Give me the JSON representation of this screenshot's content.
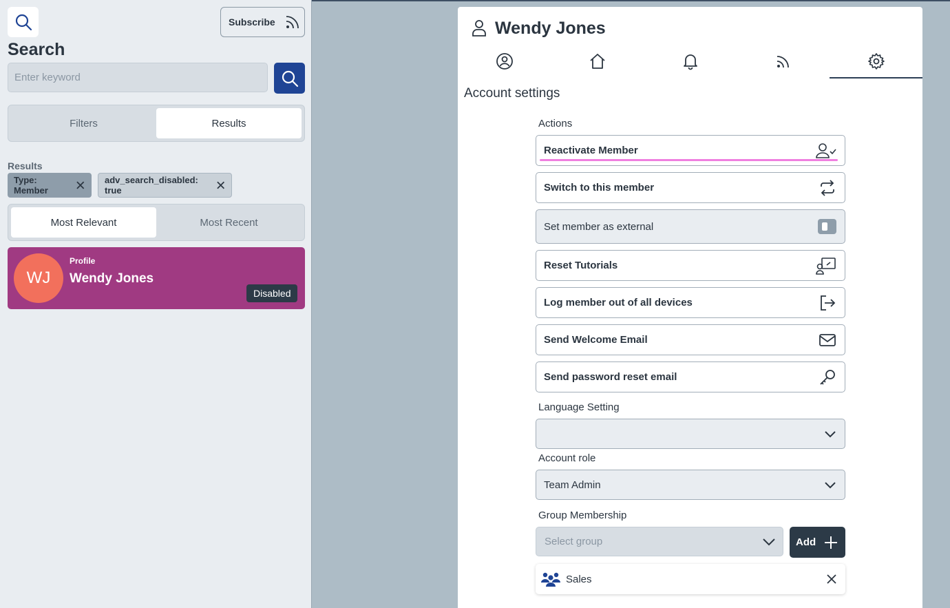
{
  "search": {
    "title": "Search",
    "placeholder": "Enter keyword",
    "subscribe_label": "Subscribe"
  },
  "view_toggle": {
    "options": [
      "Filters",
      "Results"
    ],
    "active": "Results"
  },
  "results": {
    "label": "Results",
    "chips": [
      "Type: Member",
      "adv_search_disabled: true"
    ],
    "sort_options": [
      "Most Relevant",
      "Most Recent"
    ],
    "sort_active": "Most Relevant",
    "card": {
      "kind": "Profile",
      "initials": "WJ",
      "name": "Wendy Jones",
      "status": "Disabled",
      "color": "#a03a82",
      "avatar_color": "#f2705c"
    }
  },
  "panel": {
    "title": "Wendy Jones",
    "tabs": [
      "profile-icon",
      "home-icon",
      "bell-icon",
      "feed-icon",
      "gear-icon"
    ],
    "active_tab": "gear-icon",
    "section": "Account settings",
    "actions_label": "Actions",
    "actions": [
      {
        "label": "Reactivate Member",
        "icon": "user-check-icon"
      },
      {
        "label": "Switch to this member",
        "icon": "switch-icon"
      },
      {
        "label": "Set member as external",
        "icon": "toggle-icon"
      },
      {
        "label": "Reset Tutorials",
        "icon": "presentation-icon"
      },
      {
        "label": "Log member out of all devices",
        "icon": "logout-icon"
      },
      {
        "label": "Send Welcome Email",
        "icon": "mail-icon"
      },
      {
        "label": "Send password reset email",
        "icon": "key-icon"
      }
    ],
    "language_label": "Language Setting",
    "language_value": "",
    "role_label": "Account role",
    "role_value": "Team Admin",
    "group_label": "Group Membership",
    "group_placeholder": "Select group",
    "add_label": "Add",
    "groups": [
      "Sales"
    ]
  }
}
